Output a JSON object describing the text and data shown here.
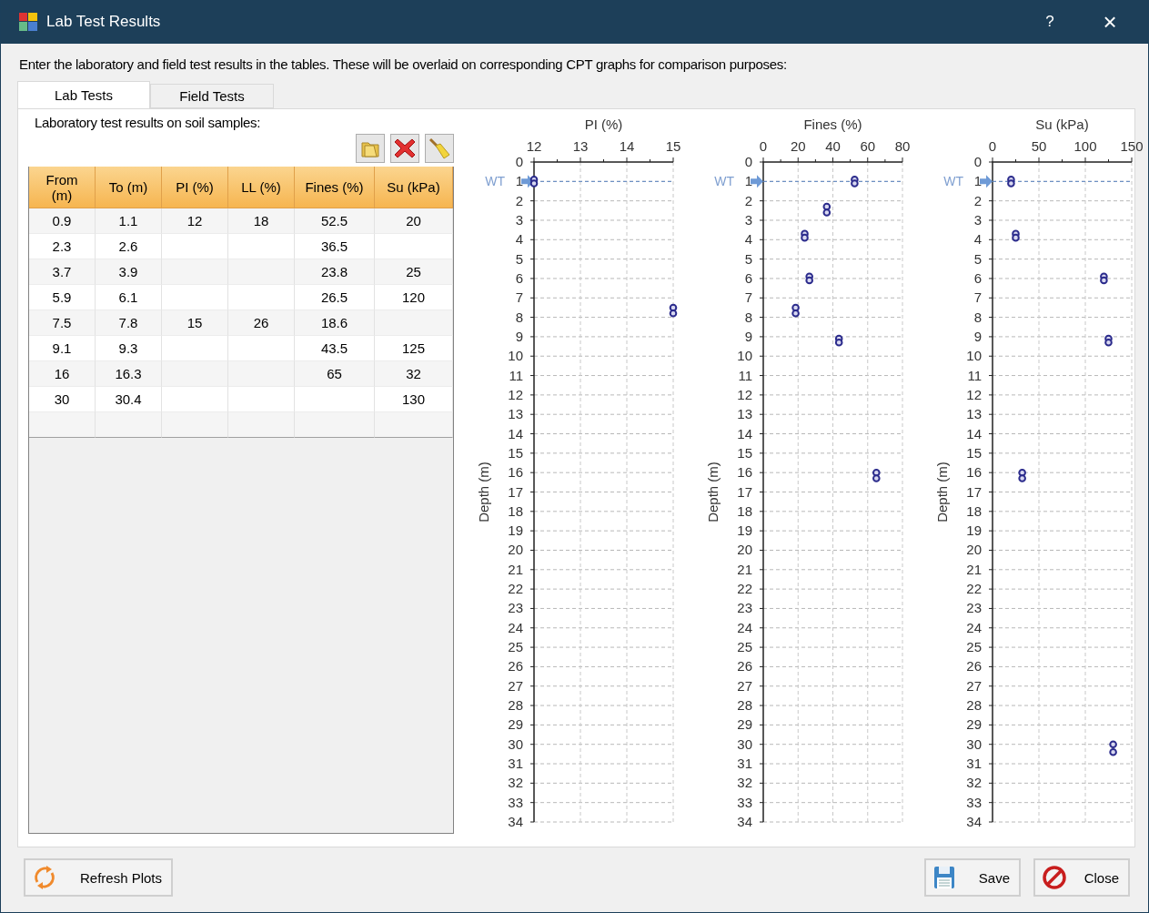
{
  "window": {
    "title": "Lab Test Results",
    "help": "?",
    "close": "×"
  },
  "intro": "Enter the laboratory and field test results in the tables. These will be overlaid on corresponding CPT graphs for comparison purposes:",
  "tabs": [
    {
      "label": "Lab Tests",
      "selected": true
    },
    {
      "label": "Field Tests",
      "selected": false
    }
  ],
  "section_label": "Laboratory test results on soil samples:",
  "table": {
    "columns": [
      "From\n(m)",
      "To (m)",
      "PI (%)",
      "LL (%)",
      "Fines (%)",
      "Su (kPa)"
    ],
    "rows": [
      [
        "0.9",
        "1.1",
        "12",
        "18",
        "52.5",
        "20"
      ],
      [
        "2.3",
        "2.6",
        "",
        "",
        "36.5",
        ""
      ],
      [
        "3.7",
        "3.9",
        "",
        "",
        "23.8",
        "25"
      ],
      [
        "5.9",
        "6.1",
        "",
        "",
        "26.5",
        "120"
      ],
      [
        "7.5",
        "7.8",
        "15",
        "26",
        "18.6",
        ""
      ],
      [
        "9.1",
        "9.3",
        "",
        "",
        "43.5",
        "125"
      ],
      [
        "16",
        "16.3",
        "",
        "",
        "65",
        "32"
      ],
      [
        "30",
        "30.4",
        "",
        "",
        "",
        "130"
      ]
    ]
  },
  "charts": [
    {
      "chart_data": {
        "type": "scatter",
        "title": "PI (%)",
        "ylabel": "Depth (m)",
        "xlim": [
          12,
          15
        ],
        "ylim": [
          34,
          0
        ],
        "xticks": [
          12,
          13,
          14,
          15
        ],
        "yticks": [
          0,
          1,
          2,
          3,
          4,
          5,
          6,
          7,
          8,
          9,
          10,
          11,
          12,
          13,
          14,
          15,
          16,
          17,
          18,
          19,
          20,
          21,
          22,
          23,
          24,
          25,
          26,
          27,
          28,
          29,
          30,
          31,
          32,
          33,
          34
        ],
        "x": [
          12,
          12,
          15,
          15
        ],
        "grid": true,
        "series": [
          {
            "color": "#2b2b8c",
            "values": [
              0.9,
              1.1,
              7.5,
              7.8
            ]
          }
        ],
        "ref_lines": [
          {
            "axis": "y",
            "value": 1,
            "label": "WT"
          }
        ]
      }
    },
    {
      "chart_data": {
        "type": "scatter",
        "title": "Fines (%)",
        "ylabel": "Depth (m)",
        "xlim": [
          0,
          80
        ],
        "ylim": [
          34,
          0
        ],
        "xticks": [
          0,
          20,
          40,
          60,
          80
        ],
        "yticks": [
          0,
          1,
          2,
          3,
          4,
          5,
          6,
          7,
          8,
          9,
          10,
          11,
          12,
          13,
          14,
          15,
          16,
          17,
          18,
          19,
          20,
          21,
          22,
          23,
          24,
          25,
          26,
          27,
          28,
          29,
          30,
          31,
          32,
          33,
          34
        ],
        "x": [
          52.5,
          52.5,
          36.5,
          36.5,
          23.8,
          23.8,
          26.5,
          26.5,
          18.6,
          18.6,
          43.5,
          43.5,
          65,
          65
        ],
        "grid": true,
        "series": [
          {
            "color": "#2b2b8c",
            "values": [
              0.9,
              1.1,
              2.3,
              2.6,
              3.7,
              3.9,
              5.9,
              6.1,
              7.5,
              7.8,
              9.1,
              9.3,
              16,
              16.3
            ]
          }
        ],
        "ref_lines": [
          {
            "axis": "y",
            "value": 1,
            "label": "WT"
          }
        ]
      }
    },
    {
      "chart_data": {
        "type": "scatter",
        "title": "Su (kPa)",
        "ylabel": "Depth (m)",
        "xlim": [
          0,
          150
        ],
        "ylim": [
          34,
          0
        ],
        "xticks": [
          0,
          50,
          100,
          150
        ],
        "yticks": [
          0,
          1,
          2,
          3,
          4,
          5,
          6,
          7,
          8,
          9,
          10,
          11,
          12,
          13,
          14,
          15,
          16,
          17,
          18,
          19,
          20,
          21,
          22,
          23,
          24,
          25,
          26,
          27,
          28,
          29,
          30,
          31,
          32,
          33,
          34
        ],
        "x": [
          20,
          20,
          25,
          25,
          120,
          120,
          125,
          125,
          32,
          32,
          130,
          130
        ],
        "grid": true,
        "series": [
          {
            "color": "#2b2b8c",
            "values": [
              0.9,
              1.1,
              3.7,
              3.9,
              5.9,
              6.1,
              9.1,
              9.3,
              16,
              16.3,
              30,
              30.4
            ]
          }
        ],
        "ref_lines": [
          {
            "axis": "y",
            "value": 1,
            "label": "WT"
          }
        ]
      }
    }
  ],
  "buttons": [
    {
      "kind": "refresh",
      "label": "Refresh Plots"
    },
    {
      "kind": "save",
      "label": "Save"
    },
    {
      "kind": "close",
      "label": "Close"
    }
  ]
}
